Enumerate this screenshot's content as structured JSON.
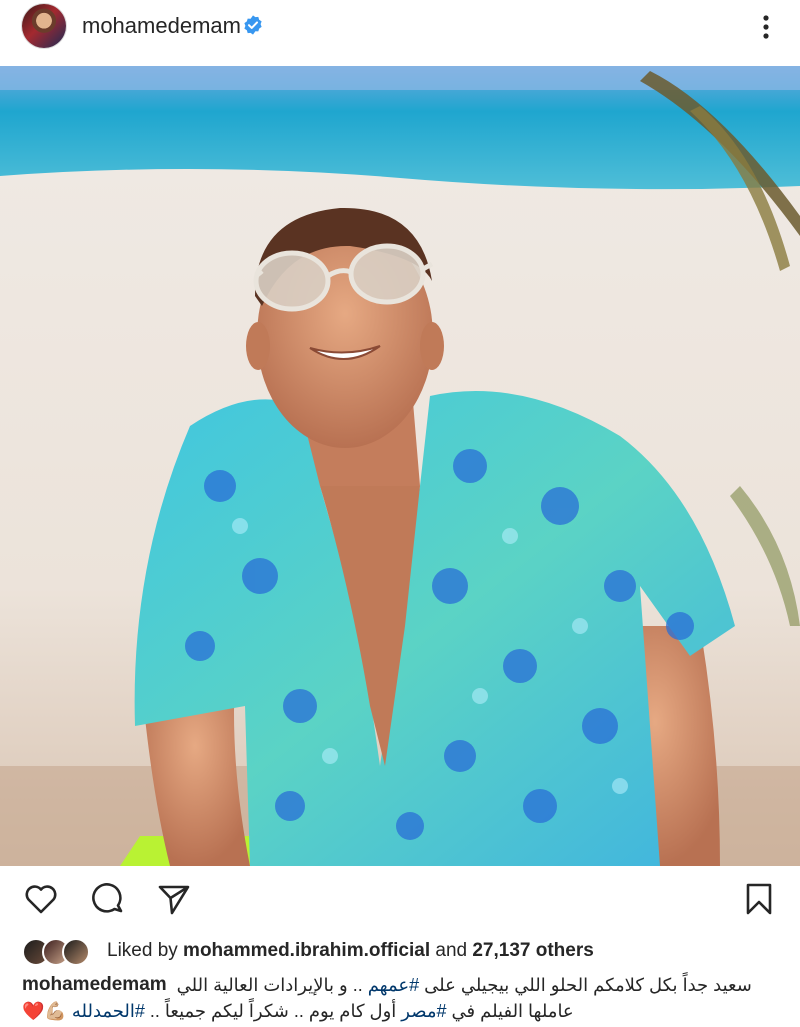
{
  "post": {
    "username": "mohamedemam",
    "verified": true,
    "more_icon": "more-vertical-icon"
  },
  "photo": {
    "subject": "man in sunglasses and blue floral shirt on beach"
  },
  "actions": {
    "like_icon": "heart-outline-icon",
    "comment_icon": "comment-icon",
    "share_icon": "send-icon",
    "save_icon": "bookmark-icon"
  },
  "likes": {
    "prefix": "Liked by ",
    "user": "mohammed.ibrahim.official",
    "middle": " and ",
    "others": "27,137 others"
  },
  "caption": {
    "username": "mohamedemam",
    "line1": "سعيد جداً بكل كلامكم الحلو اللي بيجيلي على ",
    "tag1": "#عمهم",
    "line1_end": " .. و بالإيرادات العالية اللي",
    "line2_a": "عاملها الفيلم في ",
    "tag2": "#مصر",
    "line2_b": " أول كام يوم .. شكراً ليكم جميعاً .. ",
    "tag3": "#الحمدلله",
    "emoji": "💪🏼❤️"
  },
  "colors": {
    "verified_blue": "#3897f0",
    "hashtag": "#00376b",
    "text": "#262626"
  }
}
